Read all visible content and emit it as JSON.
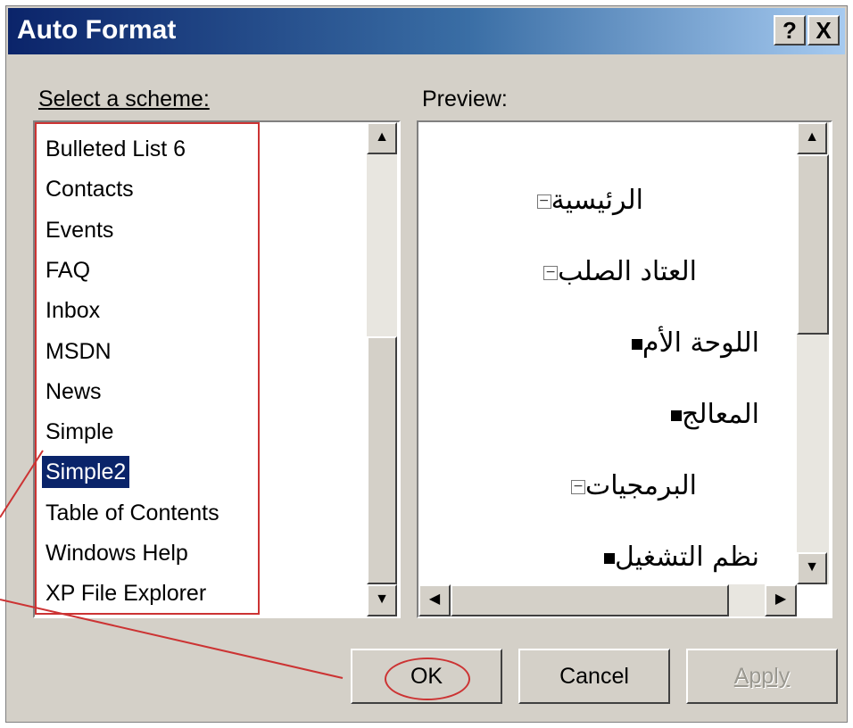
{
  "window": {
    "title": "Auto Format",
    "help_button": "?",
    "close_button": "X"
  },
  "left": {
    "label": "Select a scheme:",
    "items": [
      "Bulleted List 6",
      "Contacts",
      "Events",
      "FAQ",
      "Inbox",
      "MSDN",
      "News",
      "Simple",
      "Simple2",
      "Table of Contents",
      "Windows Help",
      "XP File Explorer"
    ],
    "selected_index": 8
  },
  "right": {
    "label": "Preview:",
    "nodes": [
      {
        "text": "الرئيسية",
        "marker": "minus-box-icon"
      },
      {
        "text": "العتاد الصلب",
        "marker": "minus-box-icon"
      },
      {
        "text": "اللوحة الأم",
        "marker": "square-bullet-icon"
      },
      {
        "text": "المعالج",
        "marker": "square-bullet-icon"
      },
      {
        "text": "البرمجيات",
        "marker": "minus-box-icon"
      },
      {
        "text": "نظم التشغيل",
        "marker": "square-bullet-icon"
      }
    ]
  },
  "buttons": {
    "ok": "OK",
    "cancel": "Cancel",
    "apply": "Apply"
  },
  "colors": {
    "selection": "#0a246a",
    "annotation": "#cc3333"
  }
}
